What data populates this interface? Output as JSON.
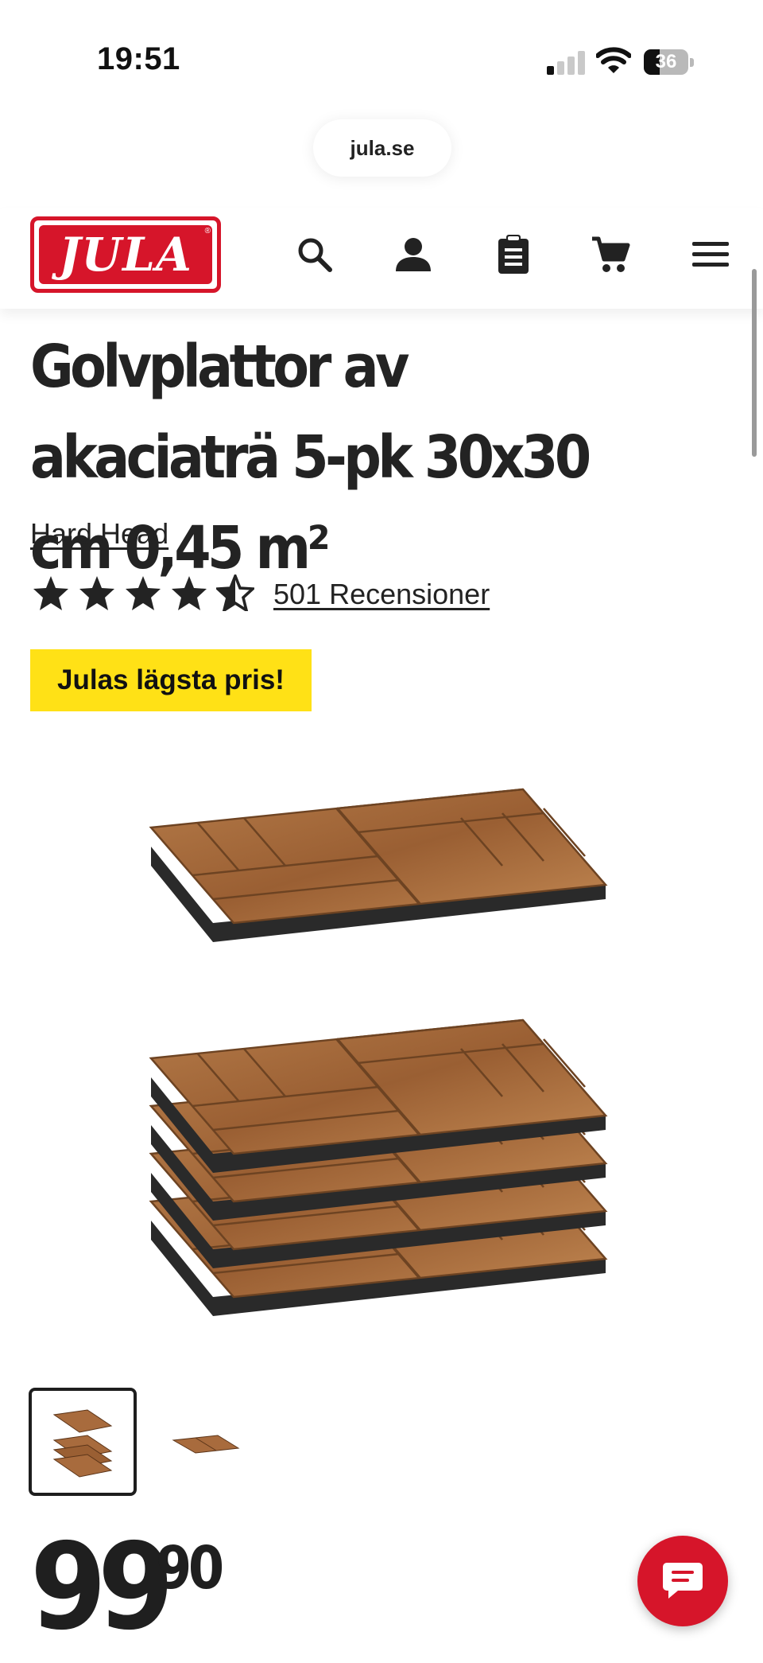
{
  "status_bar": {
    "time": "19:51",
    "battery_level": "36",
    "signal_bars_active": 1,
    "signal_bars_total": 4
  },
  "browser": {
    "url": "jula.se"
  },
  "header": {
    "logo_text": "JULA",
    "icons": [
      "search-icon",
      "account-icon",
      "shopping-list-icon",
      "cart-icon",
      "menu-icon"
    ],
    "brand_color": "#d6152a"
  },
  "product": {
    "title": "Golvplattor av akaciaträ 5-pk 30x30 cm 0,45 m²",
    "brand": "Hard Head",
    "rating": 4.5,
    "rating_max": 5,
    "reviews_label": "501 Recensioner",
    "badge": "Julas lägsta pris!",
    "badge_color": "#ffe116",
    "thumbnails_count": 2,
    "selected_thumbnail": 1,
    "price_integer": "99",
    "price_decimals": "90"
  },
  "chat": {
    "icon": "chat-icon",
    "color": "#d6152a"
  }
}
